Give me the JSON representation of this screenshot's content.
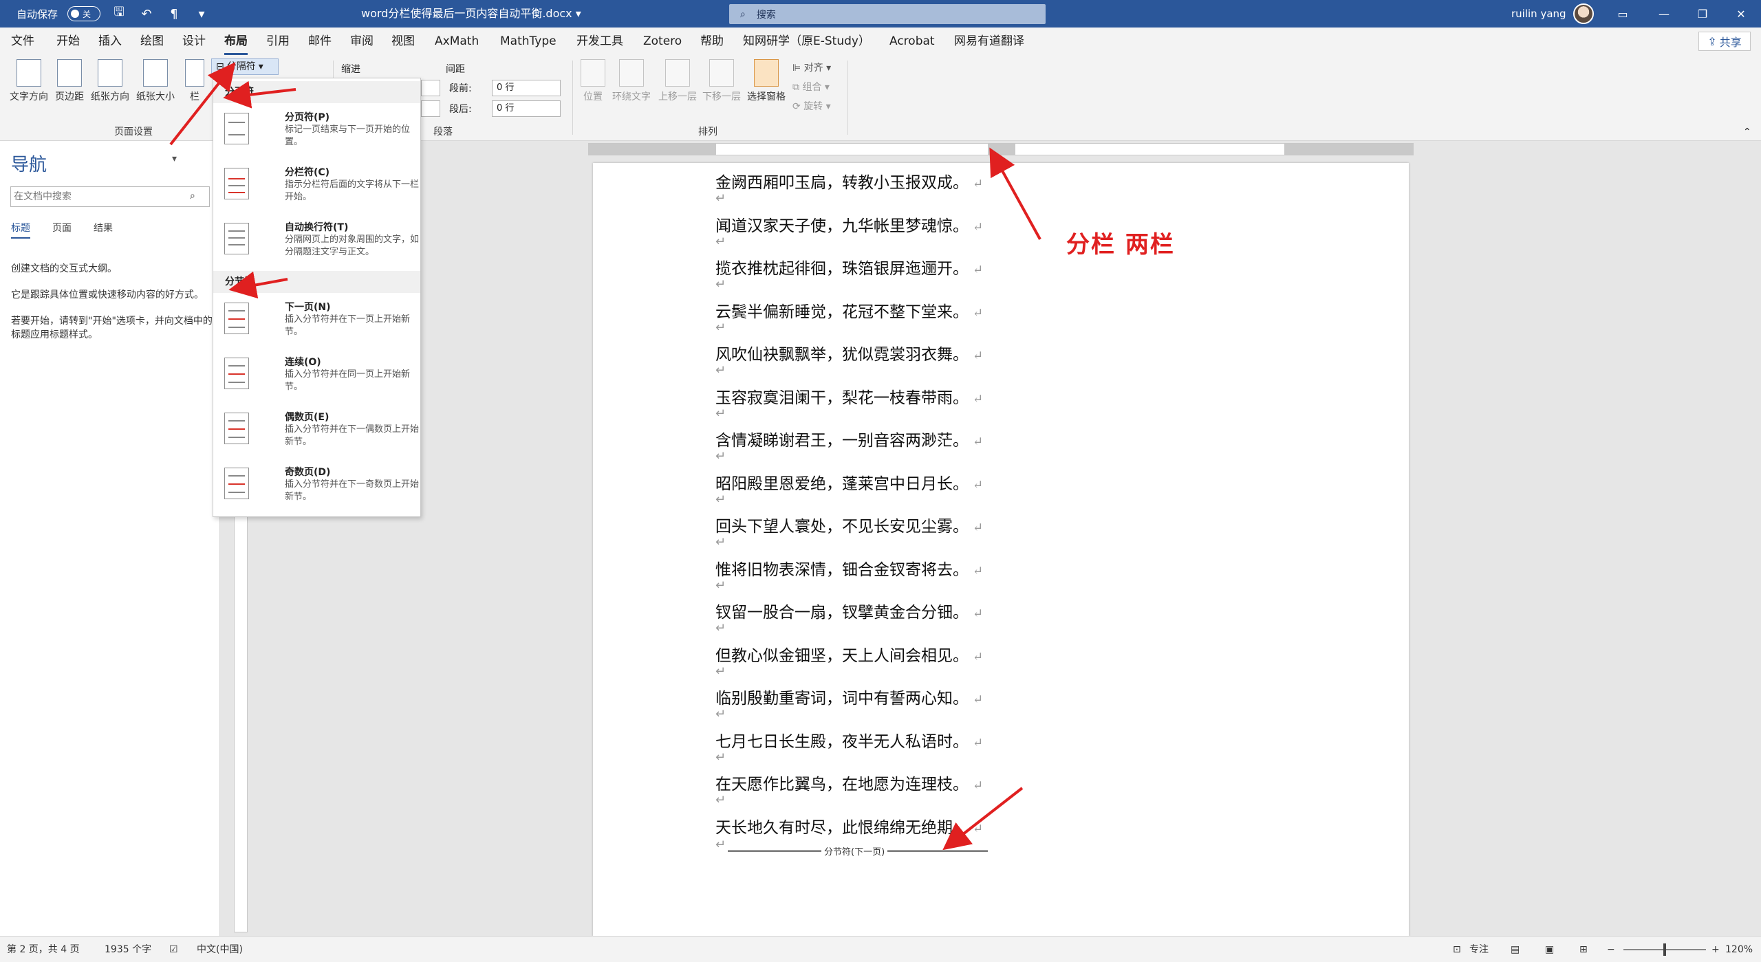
{
  "titlebar": {
    "autosave_label": "自动保存",
    "autosave_state": "关",
    "doc_title": "word分栏使得最后一页内容自动平衡.docx",
    "search_placeholder": "搜索",
    "user_name": "ruilin yang"
  },
  "tabs": [
    "文件",
    "开始",
    "插入",
    "绘图",
    "设计",
    "布局",
    "引用",
    "邮件",
    "审阅",
    "视图",
    "AxMath",
    "MathType",
    "开发工具",
    "Zotero",
    "帮助",
    "知网研学（原E-Study）",
    "Acrobat",
    "网易有道翻译"
  ],
  "active_tab": "布局",
  "share_label": "共享",
  "ribbon": {
    "page_setup_buttons": [
      "文字方向",
      "页边距",
      "纸张方向",
      "纸张大小",
      "栏"
    ],
    "page_setup_label": "页面设置",
    "breaks_button": "分隔符",
    "indent_label": "缩进",
    "spacing_label": "间距",
    "spacing_before_label": "段前:",
    "spacing_before_value": "0 行",
    "spacing_after_label": "段后:",
    "spacing_after_value": "0 行",
    "paragraph_label": "段落",
    "arrange_buttons": [
      "位置",
      "环绕文字",
      "上移一层",
      "下移一层",
      "选择窗格"
    ],
    "arrange_small": [
      "对齐",
      "组合",
      "旋转"
    ],
    "arrange_label": "排列"
  },
  "nav": {
    "title": "导航",
    "search_placeholder": "在文档中搜索",
    "tabs": [
      "标题",
      "页面",
      "结果"
    ],
    "active_tab": "标题",
    "text1": "创建文档的交互式大纲。",
    "text2": "它是跟踪具体位置或快速移动内容的好方式。",
    "text3": "若要开始，请转到\"开始\"选项卡，并向文档中的标题应用标题样式。"
  },
  "dropdown": {
    "page_breaks_header": "分页符",
    "section_breaks_header": "分节符",
    "items": [
      {
        "name": "分页符(P)",
        "desc": "标记一页结束与下一页开始的位置。"
      },
      {
        "name": "分栏符(C)",
        "desc": "指示分栏符后面的文字将从下一栏开始。"
      },
      {
        "name": "自动换行符(T)",
        "desc": "分隔网页上的对象周围的文字，如分隔题注文字与正文。"
      },
      {
        "name": "下一页(N)",
        "desc": "插入分节符并在下一页上开始新节。"
      },
      {
        "name": "连续(O)",
        "desc": "插入分节符并在同一页上开始新节。"
      },
      {
        "name": "偶数页(E)",
        "desc": "插入分节符并在下一偶数页上开始新节。"
      },
      {
        "name": "奇数页(D)",
        "desc": "插入分节符并在下一奇数页上开始新节。"
      }
    ]
  },
  "document": {
    "lines": [
      "金阙西厢叩玉扃，转教小玉报双成。",
      "闻道汉家天子使，九华帐里梦魂惊。",
      "揽衣推枕起徘徊，珠箔银屏迤逦开。",
      "云鬓半偏新睡觉，花冠不整下堂来。",
      "风吹仙袂飘飘举，犹似霓裳羽衣舞。",
      "玉容寂寞泪阑干，梨花一枝春带雨。",
      "含情凝睇谢君王，一别音容两渺茫。",
      "昭阳殿里恩爱绝，蓬莱宫中日月长。",
      "回头下望人寰处，不见长安见尘雾。",
      "惟将旧物表深情，钿合金钗寄将去。",
      "钗留一股合一扇，钗擘黄金合分钿。",
      "但教心似金钿坚，天上人间会相见。",
      "临别殷勤重寄词，词中有誓两心知。",
      "七月七日长生殿，夜半无人私语时。",
      "在天愿作比翼鸟，在地愿为连理枝。",
      "天长地久有时尽，此恨绵绵无绝期。"
    ],
    "paragraph_mark": "↵",
    "section_break_label": "分节符(下一页)"
  },
  "annotation": "分栏  两栏",
  "status": {
    "page": "第 2 页，共 4 页",
    "words": "1935 个字",
    "language": "中文(中国)",
    "focus": "专注",
    "zoom": "120%",
    "zoom_fraction": 0.5
  },
  "colors": {
    "title_blue": "#2b579a",
    "annotation_red": "#e02020"
  }
}
